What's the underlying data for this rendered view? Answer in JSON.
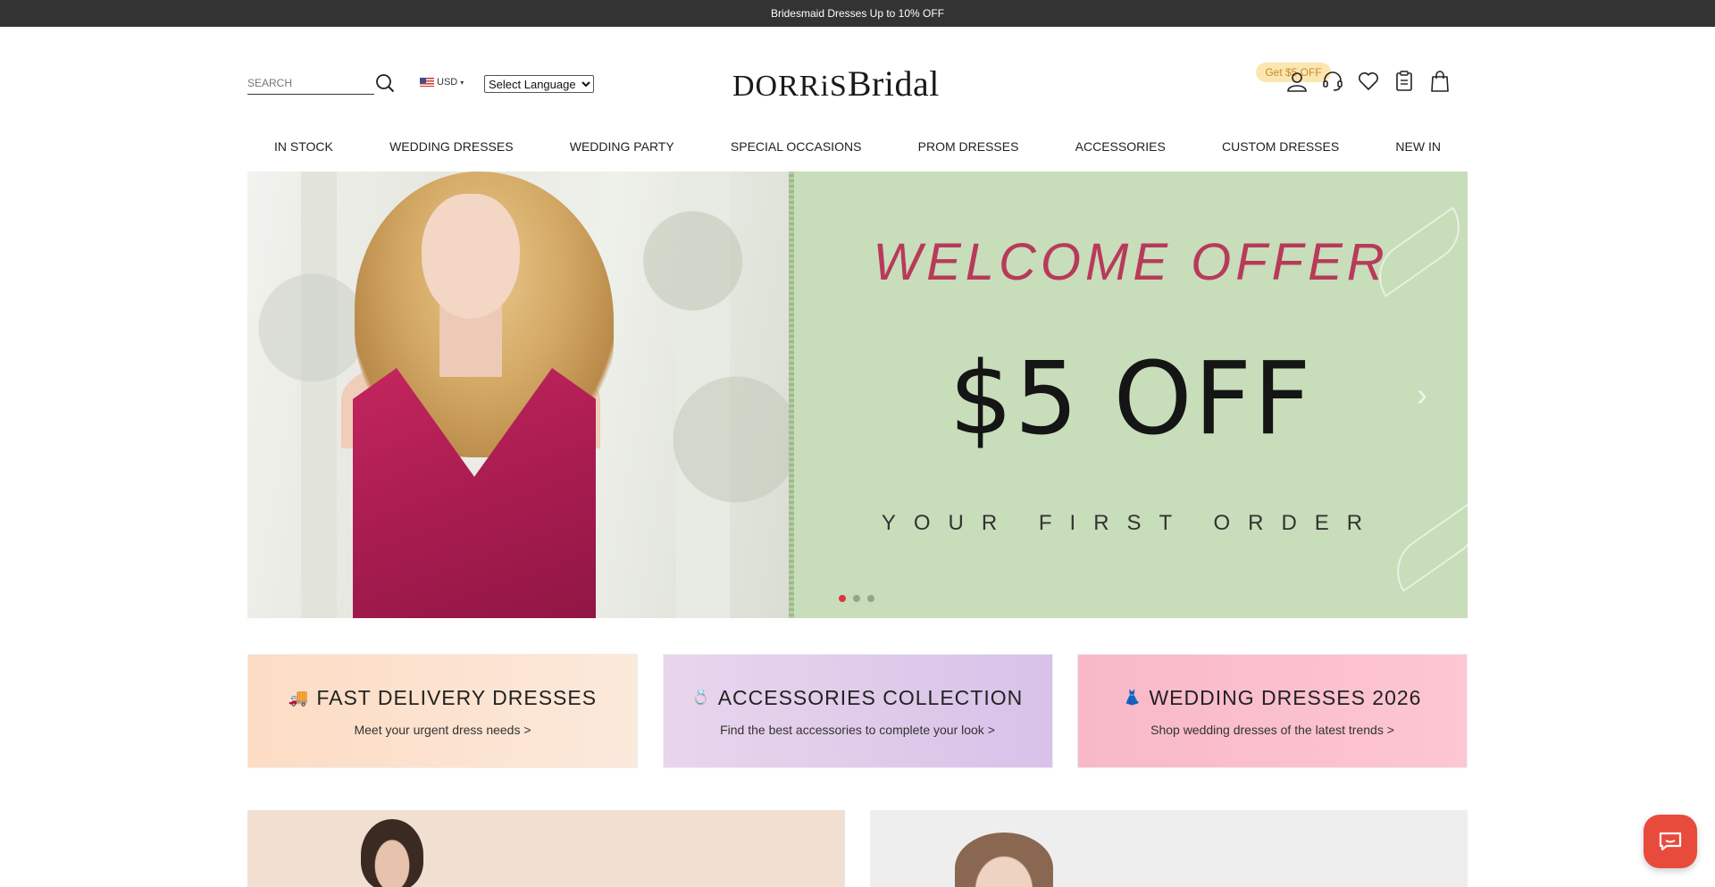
{
  "announcement": "Bridesmaid Dresses Up to 10% OFF",
  "header": {
    "search_placeholder": "SEARCH",
    "currency": "USD",
    "language": "Select Language",
    "logo_part1": "DORRiS",
    "logo_part2": "Bridal",
    "promo_pill": "Get $5 OFF"
  },
  "icons": [
    "account-icon",
    "support-icon",
    "wishlist-icon",
    "orders-icon",
    "cart-icon"
  ],
  "nav": [
    "IN STOCK",
    "WEDDING DRESSES",
    "WEDDING PARTY",
    "SPECIAL OCCASIONS",
    "PROM DRESSES",
    "ACCESSORIES",
    "CUSTOM DRESSES",
    "NEW IN"
  ],
  "hero": {
    "headline": "WELCOME OFFER",
    "offer": "$5 OFF",
    "subline": "YOUR FIRST ORDER",
    "slide_count": 3,
    "active_slide": 1
  },
  "promo_cards": [
    {
      "icon": "truck-icon",
      "glyph": "🚚",
      "title": "FAST DELIVERY DRESSES",
      "subtitle": "Meet your urgent dress needs >"
    },
    {
      "icon": "ring-icon",
      "glyph": "💍",
      "title": "ACCESSORIES COLLECTION",
      "subtitle": "Find the best accessories to complete your look >"
    },
    {
      "icon": "dress-icon",
      "glyph": "👗",
      "title": "WEDDING DRESSES 2026",
      "subtitle": "Shop wedding dresses of the latest trends >"
    }
  ],
  "colors": {
    "topbar": "#333333",
    "accent": "#e84b3c",
    "hero_bg": "#c8ddba",
    "headline": "#b83a5a",
    "pill_bg": "#fbe6b0",
    "pill_text": "#c7892b"
  }
}
